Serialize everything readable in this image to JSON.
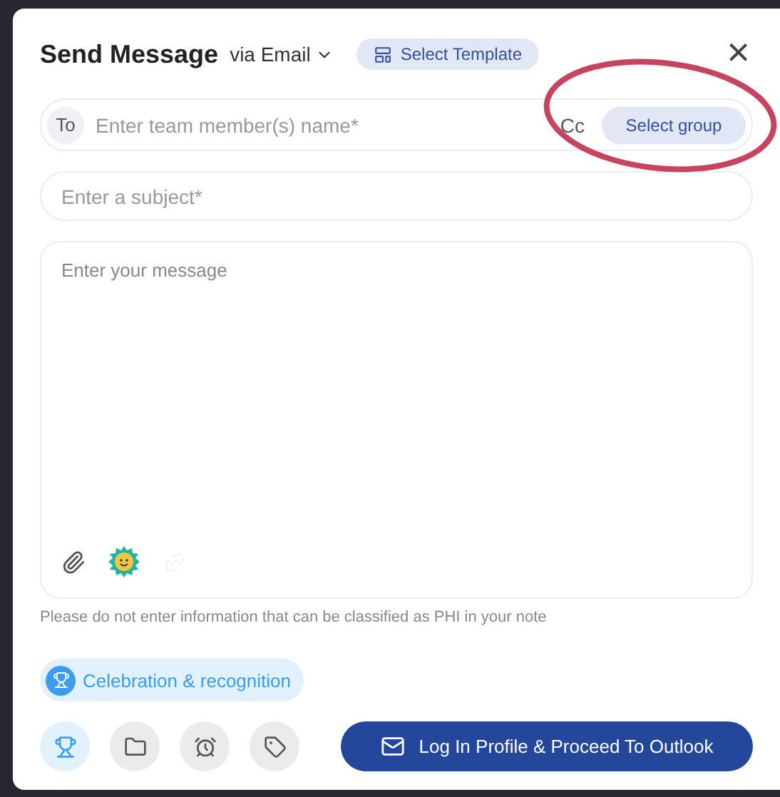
{
  "dialog": {
    "title": "Send Message",
    "channel": "via Email",
    "template_button": "Select Template",
    "close": "×"
  },
  "to_field": {
    "label": "To",
    "placeholder": "Enter team member(s) name*",
    "cc_label": "Cc",
    "group_button": "Select group"
  },
  "subject_field": {
    "placeholder": "Enter a subject*"
  },
  "message_field": {
    "placeholder": "Enter your message"
  },
  "message_tools": [
    {
      "kind": "attach",
      "disabled": false
    },
    {
      "kind": "emoji",
      "disabled": false
    },
    {
      "kind": "link",
      "disabled": true
    }
  ],
  "note": "Please do not enter information that can be classified as PHI in your note",
  "category_chip": {
    "label": "Celebration & recognition"
  },
  "categories": [
    {
      "kind": "trophy",
      "selected": true
    },
    {
      "kind": "folder",
      "selected": false
    },
    {
      "kind": "alarm",
      "selected": false
    },
    {
      "kind": "tag",
      "selected": false
    }
  ],
  "submit_button": "Log In Profile & Proceed To Outlook",
  "annotation": {
    "kind": "ellipse",
    "color": "#c8435e"
  }
}
